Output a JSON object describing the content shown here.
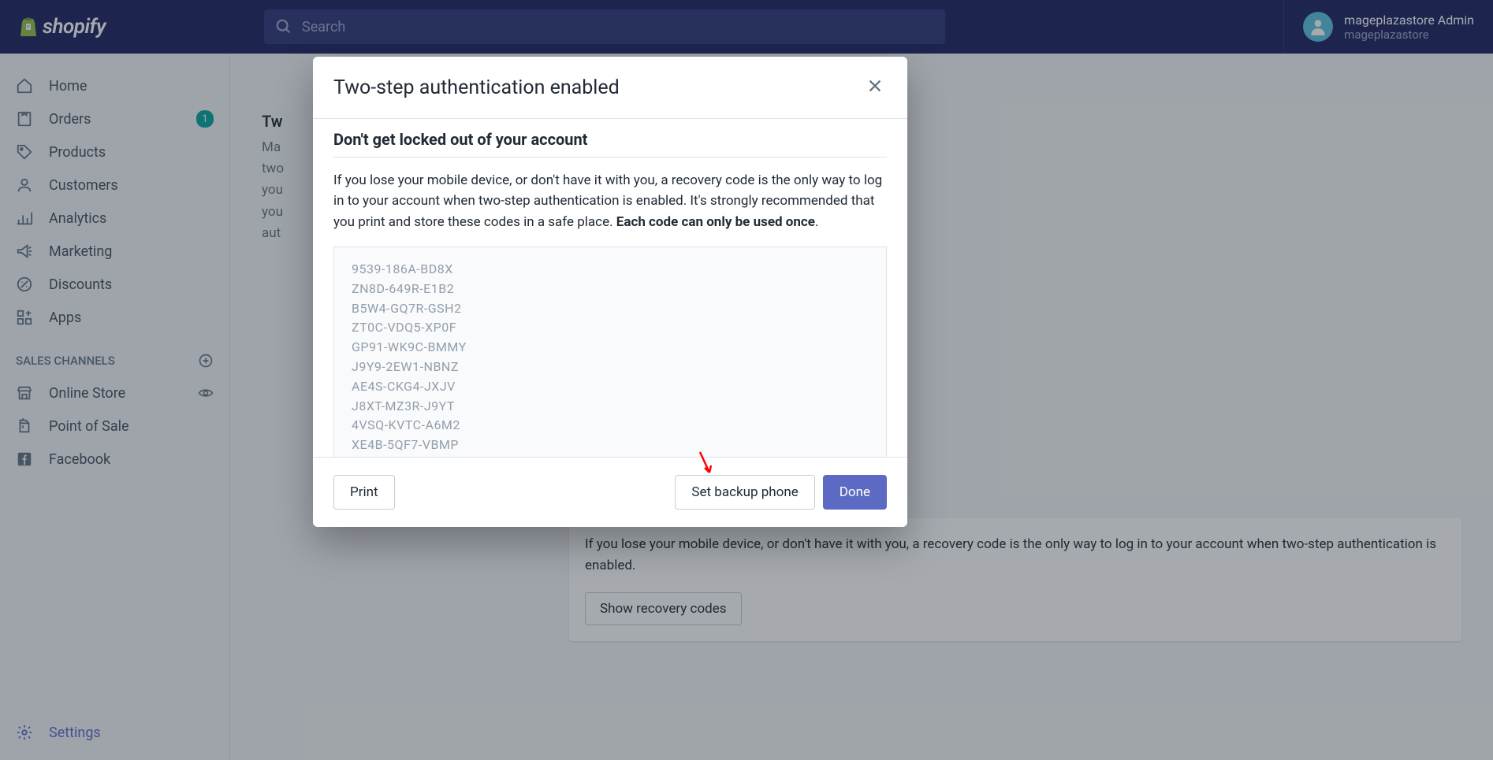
{
  "brand": "shopify",
  "search": {
    "placeholder": "Search"
  },
  "user": {
    "name": "mageplazastore Admin",
    "store": "mageplazastore"
  },
  "sidebar": {
    "items": [
      {
        "label": "Home"
      },
      {
        "label": "Orders",
        "badge": "1"
      },
      {
        "label": "Products"
      },
      {
        "label": "Customers"
      },
      {
        "label": "Analytics"
      },
      {
        "label": "Marketing"
      },
      {
        "label": "Discounts"
      },
      {
        "label": "Apps"
      }
    ],
    "section_label": "SALES CHANNELS",
    "channels": [
      {
        "label": "Online Store"
      },
      {
        "label": "Point of Sale"
      },
      {
        "label": "Facebook"
      }
    ],
    "settings": "Settings"
  },
  "background": {
    "heading_partial": "Tw",
    "desc_prefix": "Ma",
    "desc_l2": "two",
    "desc_l3": "you",
    "desc_l4": "you",
    "desc_l5": "aut",
    "card_text": "If you lose your mobile device, or don't have it with you, a recovery code is the only way to log in to your account when two-step authentication is enabled.",
    "card_btn": "Show recovery codes"
  },
  "modal": {
    "title": "Two-step authentication enabled",
    "subtitle": "Don't get locked out of your account",
    "text_p1": "If you lose your mobile device, or don't have it with you, a recovery code is the only way to log in to your account when two-step authentication is enabled. It's strongly recommended that you print and store these codes in a safe place. ",
    "text_bold": "Each code can only be used once",
    "text_end": ".",
    "codes": [
      "9539-186A-BD8X",
      "ZN8D-649R-E1B2",
      "B5W4-GQ7R-GSH2",
      "ZT0C-VDQ5-XP0F",
      "GP91-WK9C-BMMY",
      "J9Y9-2EW1-NBNZ",
      "AE4S-CKG4-JXJV",
      "J8XT-MZ3R-J9YT",
      "4VSQ-KVTC-A6M2",
      "XE4B-5QF7-VBMP"
    ],
    "btn_print": "Print",
    "btn_backup": "Set backup phone",
    "btn_done": "Done"
  }
}
